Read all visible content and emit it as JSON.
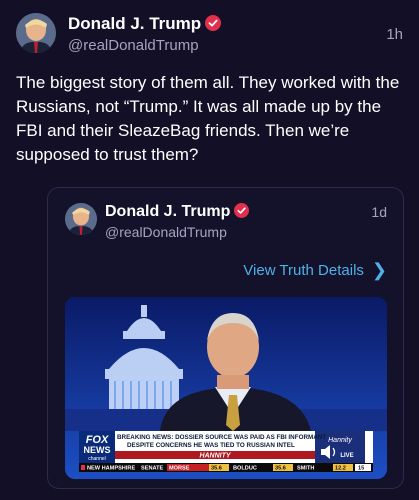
{
  "post": {
    "author_name": "Donald J. Trump",
    "author_handle": "@realDonaldTrump",
    "time_ago": "1h",
    "text": "The biggest story of them all. They worked with the Russians, not “Trump.” It was all made up by the FBI and their SleazeBag friends. Then we’re supposed to trust them?"
  },
  "quoted": {
    "author_name": "Donald J. Trump",
    "author_handle": "@realDonaldTrump",
    "time_ago": "1d",
    "view_details_label": "View Truth Details",
    "video": {
      "network_top": "FOX",
      "network_bottom": "NEWS",
      "network_sub": "channel",
      "breaking_line1": "BREAKING NEWS: DOSSIER SOURCE WAS PAID AS FBI INFORMANT",
      "breaking_line2": "DESPITE CONCERNS HE WAS TIED TO RUSSIAN INTEL",
      "show_name": "HANNITY",
      "show_logo": "Hannity",
      "live_badge": "LIVE",
      "ticker_items": [
        "NEW HAMPSHIRE",
        "SENATE",
        "MORSE",
        "35.6",
        "BOLDUC",
        "35.6",
        "SMITH",
        "12.2",
        "15"
      ]
    }
  },
  "colors": {
    "background": "#120f27",
    "verified_badge": "#e0304e",
    "link": "#4fb1e8",
    "secondary_text": "#a6a3c2"
  }
}
